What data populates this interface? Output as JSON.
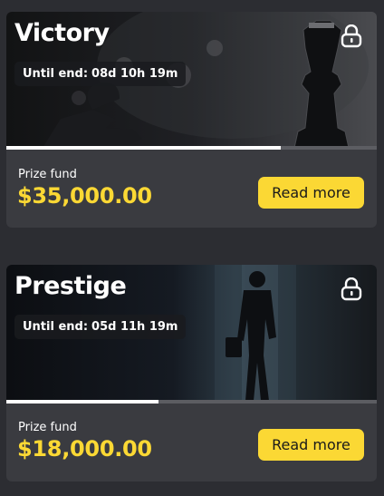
{
  "cards": [
    {
      "title": "Victory",
      "timer_prefix": "Until end:",
      "timer_value": "08d 10h 19m",
      "progress_fraction": 0.74,
      "prize_label": "Prize fund",
      "prize_amount": "$35,000.00",
      "button_label": "Read more",
      "banner_image": "chess-pieces",
      "icon": "lock-icon"
    },
    {
      "title": "Prestige",
      "timer_prefix": "Until end:",
      "timer_value": "05d 11h 19m",
      "progress_fraction": 0.41,
      "prize_label": "Prize fund",
      "prize_amount": "$18,000.00",
      "button_label": "Read more",
      "banner_image": "businessman-walking",
      "icon": "lock-icon"
    }
  ],
  "colors": {
    "background": "#2c2d32",
    "card": "#3a3b40",
    "accent": "#fbd834",
    "text": "#ffffff"
  }
}
